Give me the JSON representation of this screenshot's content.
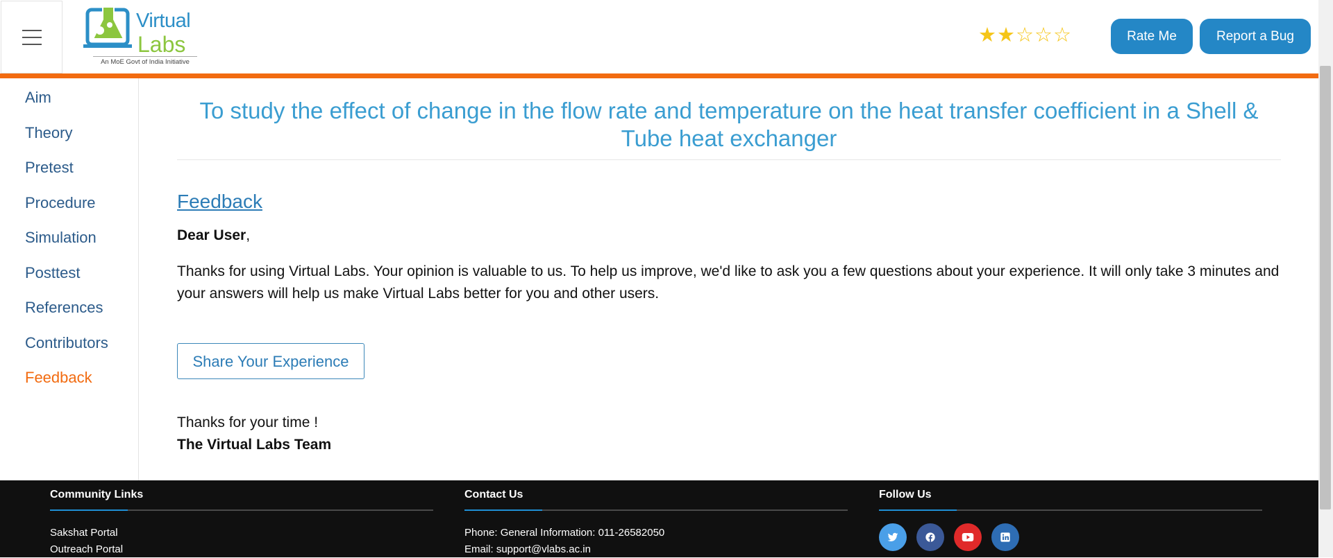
{
  "header": {
    "logo": {
      "word1": "Virtual",
      "word2": "Labs",
      "tagline": "An MoE Govt of India Initiative"
    },
    "rating": {
      "filled": 2,
      "total": 5,
      "color": "#f5c518"
    },
    "rate_label": "Rate Me",
    "bug_label": "Report a Bug"
  },
  "sidebar": {
    "items": [
      {
        "label": "Aim"
      },
      {
        "label": "Theory"
      },
      {
        "label": "Pretest"
      },
      {
        "label": "Procedure"
      },
      {
        "label": "Simulation"
      },
      {
        "label": "Posttest"
      },
      {
        "label": "References"
      },
      {
        "label": "Contributors"
      },
      {
        "label": "Feedback",
        "active": true
      }
    ]
  },
  "main": {
    "title": "To study the effect of change in the flow rate and temperature on the heat transfer coefficient in a Shell & Tube heat exchanger",
    "section_heading": "Feedback",
    "greeting_bold": "Dear User",
    "greeting_suffix": ",",
    "body": "Thanks for using Virtual Labs. Your opinion is valuable to us. To help us improve, we'd like to ask you a few questions about your experience. It will only take 3 minutes and your answers will help us make Virtual Labs better for you and other users.",
    "share_label": "Share Your Experience",
    "thanks": "Thanks for your time !",
    "signature": "The Virtual Labs Team"
  },
  "footer": {
    "community": {
      "title": "Community Links",
      "links": [
        "Sakshat Portal",
        "Outreach Portal"
      ]
    },
    "contact": {
      "title": "Contact Us",
      "lines": [
        "Phone: General Information: 011-26582050",
        "Email: support@vlabs.ac.in"
      ]
    },
    "follow": {
      "title": "Follow Us",
      "icons": [
        {
          "name": "twitter-icon",
          "color": "#4a9fe8"
        },
        {
          "name": "facebook-icon",
          "color": "#3b5998"
        },
        {
          "name": "youtube-icon",
          "color": "#e02a2a"
        },
        {
          "name": "linkedin-icon",
          "color": "#2e6db4"
        }
      ]
    }
  },
  "colors": {
    "accent_orange": "#f26b10",
    "link_blue": "#2c7cb6",
    "title_blue": "#3a9dd1",
    "button_blue": "#2487c6"
  }
}
